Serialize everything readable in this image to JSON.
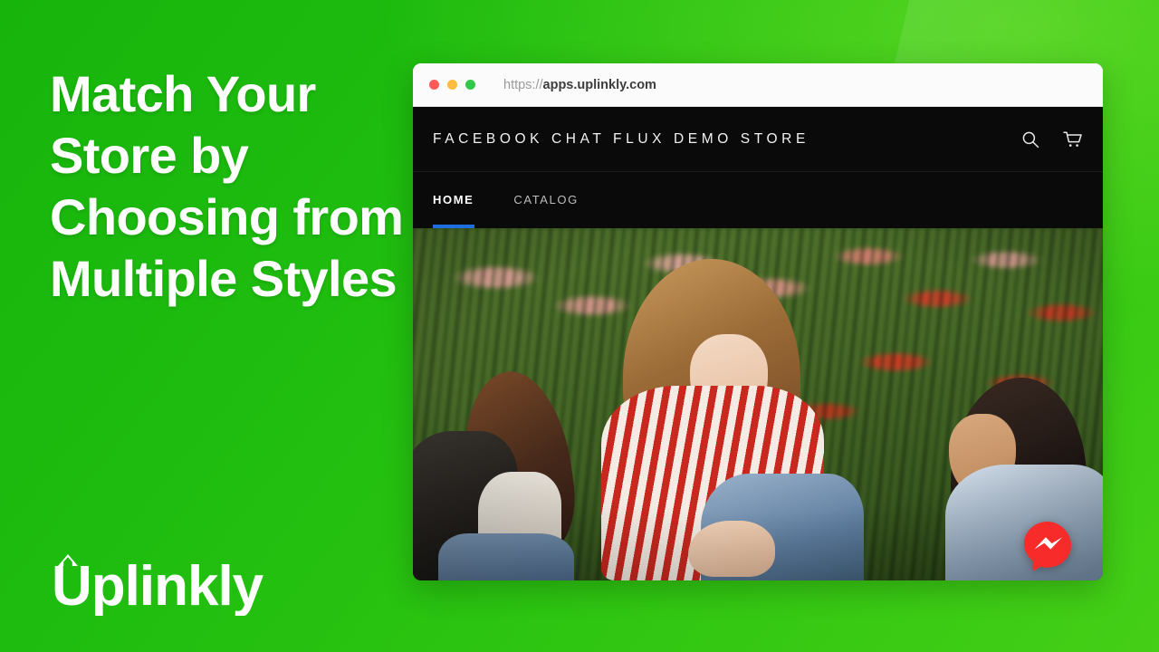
{
  "theme": {
    "bg_green_dark": "#17b40c",
    "bg_green_light": "#45cf16",
    "accent_blue": "#1d6fe0",
    "messenger_red": "#f82b2b",
    "store_black": "#0a0a0a"
  },
  "left_panel": {
    "headline": "Match Your Store by Choosing from Multiple Styles",
    "headline_lines": [
      "Match Your",
      "Store by",
      "Choosing from",
      "Multiple Styles"
    ],
    "logo": {
      "wordmark": "Uplinkly",
      "icon": "up-arrow-icon"
    }
  },
  "browser": {
    "traffic_lights": [
      "close-red",
      "minimize-yellow",
      "maximize-green"
    ],
    "url_scheme": "https://",
    "url_host": "apps.uplinkly.com",
    "url_full": "https://apps.uplinkly.com"
  },
  "store": {
    "name": "FACEBOOK CHAT FLUX DEMO STORE",
    "header_icons": [
      {
        "name": "search-icon",
        "label": "Search"
      },
      {
        "name": "cart-icon",
        "label": "Cart"
      }
    ],
    "nav": [
      {
        "label": "HOME",
        "active": true
      },
      {
        "label": "CATALOG",
        "active": false
      }
    ],
    "hero": {
      "alt": "Three women laughing together in a field of pink and red tulips",
      "people": [
        "woman-black-leather-jacket",
        "woman-red-striped-shirt",
        "woman-denim-jacket"
      ]
    },
    "chat_widget": {
      "name": "messenger-bubble",
      "color": "#f82b2b"
    }
  }
}
